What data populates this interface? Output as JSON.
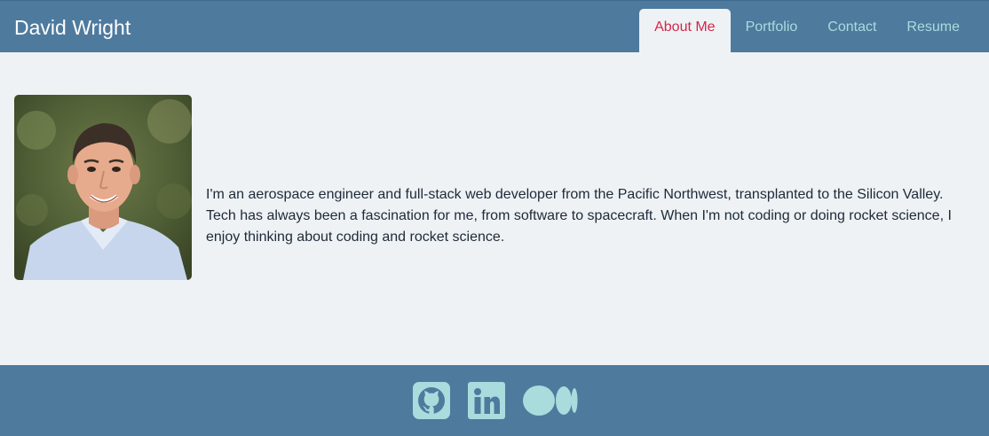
{
  "header": {
    "brand": "David Wright",
    "nav": [
      {
        "label": "About Me",
        "active": true
      },
      {
        "label": "Portfolio",
        "active": false
      },
      {
        "label": "Contact",
        "active": false
      },
      {
        "label": "Resume",
        "active": false
      }
    ]
  },
  "main": {
    "bio": "I'm an aerospace engineer and full-stack web developer from the Pacific Northwest, transplanted to the Silicon Valley. Tech has always been a fascination for me, from software to spacecraft. When I'm not coding or doing rocket science, I enjoy thinking about coding and rocket science."
  },
  "footer": {
    "social_icons": [
      "github-icon",
      "linkedin-icon",
      "medium-icon"
    ]
  },
  "colors": {
    "header_bg": "#4e7a9e",
    "page_bg": "#eef2f5",
    "nav_text": "#a9dcdc",
    "active_nav_text": "#d6264a",
    "icon_color": "#a9dcdc"
  }
}
